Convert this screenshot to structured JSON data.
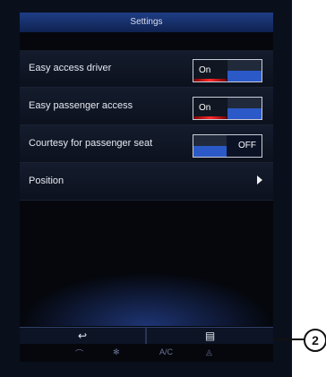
{
  "header": {
    "title": "Settings"
  },
  "rows": [
    {
      "label": "Easy access driver",
      "state": "On"
    },
    {
      "label": "Easy passenger access",
      "state": "On"
    },
    {
      "label": "Courtesy for passenger seat",
      "state": "OFF"
    },
    {
      "label": "Position"
    }
  ],
  "bottom_bar": {
    "back_icon": "↩",
    "menu_icon": "▤"
  },
  "status_bar": {
    "ac_label": "A/C"
  },
  "callout": {
    "number": "2"
  }
}
